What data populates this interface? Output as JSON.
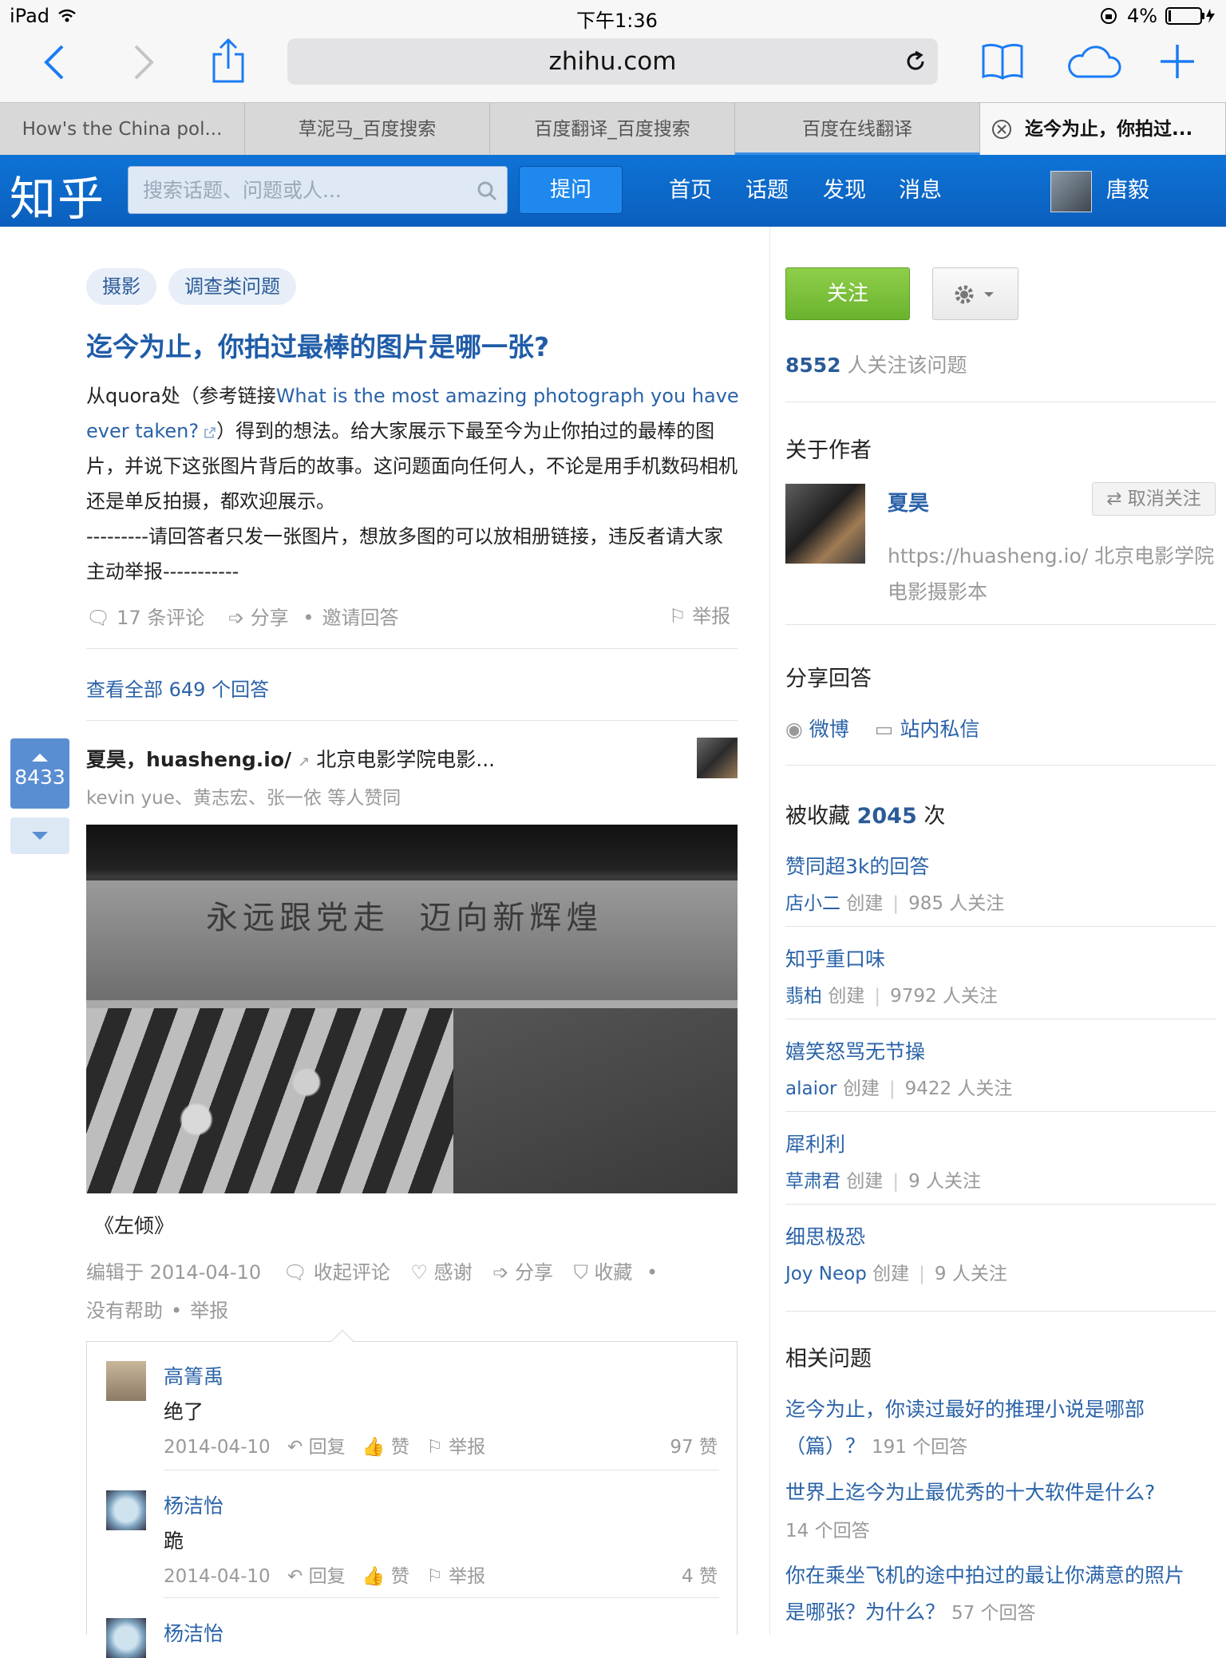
{
  "status": {
    "device": "iPad",
    "time": "下午1:36",
    "battery": "4%"
  },
  "browser": {
    "url": "zhihu.com",
    "tabs": [
      "How's the China pol...",
      "草泥马_百度搜索",
      "百度翻译_百度搜索",
      "百度在线翻译",
      "迄今为止，你拍过..."
    ]
  },
  "header": {
    "logo": "知乎",
    "search_placeholder": "搜索话题、问题或人...",
    "ask_label": "提问",
    "nav": [
      "首页",
      "话题",
      "发现",
      "消息"
    ],
    "user_name": "唐毅"
  },
  "question": {
    "topics": [
      "摄影",
      "调查类问题"
    ],
    "title": "迄今为止，你拍过最棒的图片是哪一张?",
    "body_pre": "从quora处（参考链接",
    "body_link": "What is the most amazing photograph you have ever taken?",
    "body_post": "）得到的想法。给大家展示下最至今为止你拍过的最棒的图片，并说下这张图片背后的故事。这问题面向任何人，不论是用手机数码相机还是单反拍摄，都欢迎展示。",
    "body_note": "---------请回答者只发一张图片，想放多图的可以放相册链接，违反者请大家主动举报-----------",
    "comments": "17 条评论",
    "share": "分享",
    "invite": "邀请回答",
    "report": "举报",
    "view_all": "查看全部 649 个回答"
  },
  "answer": {
    "votes": "8433",
    "author": "夏昊，",
    "author_link": "huasheng.io/",
    "author_bio": "北京电影学院电影...",
    "voters": "kevin yue、黄志宏、张一依 等人赞同",
    "photo_banner": "永远跟党走  迈向新辉煌",
    "caption": "《左倾》",
    "edited": "编辑于 2014-04-10",
    "actions": [
      "收起评论",
      "感谢",
      "分享",
      "收藏"
    ],
    "actions2": [
      "没有帮助",
      "举报"
    ]
  },
  "comments": [
    {
      "name": "高箐禹",
      "text": "绝了",
      "date": "2014-04-10",
      "reply": "回复",
      "like": "赞",
      "report": "举报",
      "likes": "97 赞"
    },
    {
      "name": "杨洁怡",
      "text": "跪",
      "date": "2014-04-10",
      "reply": "回复",
      "like": "赞",
      "report": "举报",
      "likes": "4 赞"
    },
    {
      "name": "杨洁怡"
    }
  ],
  "sidebar": {
    "follow_label": "关注",
    "follower_count": "8552",
    "follower_text": "人关注该问题",
    "about_author": "关于作者",
    "author_name": "夏昊",
    "unfollow_label": "取消关注",
    "author_bio": "https://huasheng.io/ 北京电影学院电影摄影本",
    "share_title": "分享回答",
    "share_weibo": "微博",
    "share_pm": "站内私信",
    "collected_prefix": "被收藏",
    "collected_count": "2045",
    "collected_suffix": "次",
    "collections": [
      {
        "name": "赞同超3k的回答",
        "creator": "店小二",
        "created": "创建",
        "followers": "985 人关注"
      },
      {
        "name": "知乎重口味",
        "creator": "翡柏",
        "created": "创建",
        "followers": "9792 人关注"
      },
      {
        "name": "嬉笑怒骂无节操",
        "creator": "alaior",
        "created": "创建",
        "followers": "9422 人关注"
      },
      {
        "name": "犀利利",
        "creator": "草肃君",
        "created": "创建",
        "followers": "9 人关注"
      },
      {
        "name": "细思极恐",
        "creator": "Joy Neop",
        "created": "创建",
        "followers": "9 人关注"
      }
    ],
    "related_title": "相关问题",
    "related": [
      {
        "q1": "迄今为止，你读过最好的推理小说是哪部",
        "q2": "（篇）？",
        "count": "191 个回答"
      },
      {
        "q1": "世界上迄今为止最优秀的十大软件是什么?",
        "q2": "",
        "count": "14 个回答"
      },
      {
        "q1": "你在乘坐飞机的途中拍过的最让你满意的照片",
        "q2": "是哪张？为什么？",
        "count": "57 个回答"
      }
    ]
  }
}
